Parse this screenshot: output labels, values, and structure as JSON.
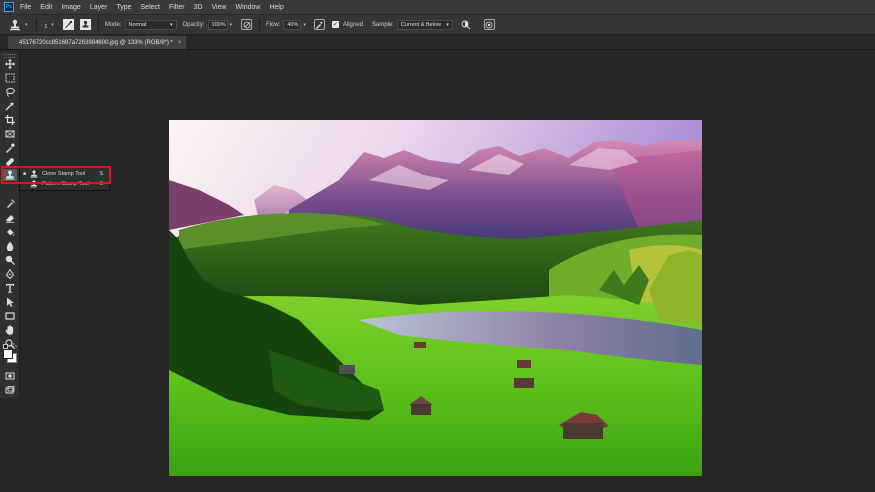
{
  "app": {
    "logo": "Ps"
  },
  "menubar": {
    "items": [
      "File",
      "Edit",
      "Image",
      "Layer",
      "Type",
      "Select",
      "Filter",
      "3D",
      "View",
      "Window",
      "Help"
    ]
  },
  "options": {
    "brush_size": "1",
    "mode_label": "Mode:",
    "mode_value": "Normal",
    "opacity_label": "Opacity:",
    "opacity_value": "100%",
    "flow_label": "Flow:",
    "flow_value": "40%",
    "aligned_label": "Aligned",
    "sample_label": "Sample:",
    "sample_value": "Current & Below"
  },
  "document_tab": {
    "title": "45176720cc851687a7263984600.jpg @ 133% (RGB/8*) *",
    "close": "×"
  },
  "tool_popup": {
    "items": [
      {
        "label": "Clone Stamp Tool",
        "shortcut": "S",
        "selected": true
      },
      {
        "label": "Pattern Stamp Tool",
        "shortcut": "S",
        "selected": false
      }
    ]
  },
  "colors": {
    "highlight": "#e3101e",
    "accent": "#31a8ff"
  }
}
